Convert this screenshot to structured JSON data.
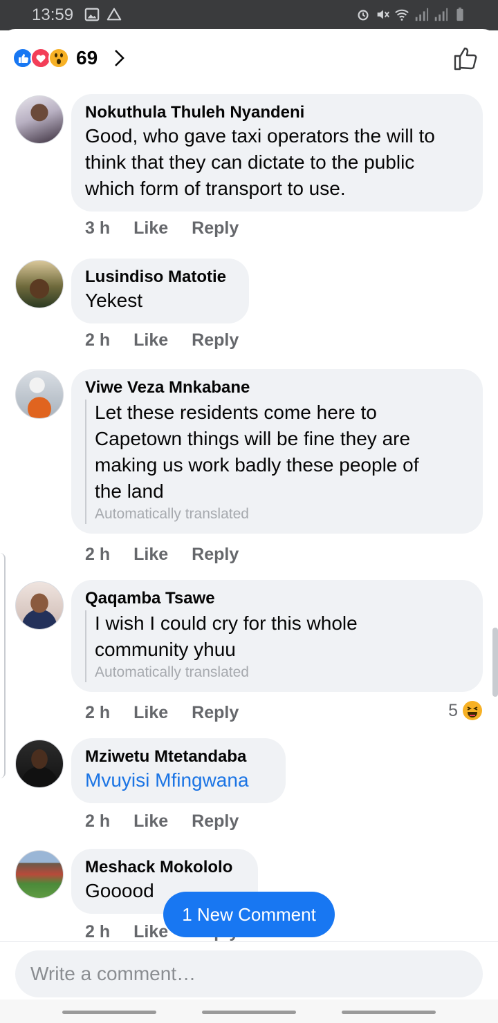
{
  "status_bar": {
    "time": "13:59",
    "left_icons": [
      "image-icon",
      "drive-icon"
    ],
    "right_icons": [
      "alarm-icon",
      "mute-icon",
      "wifi-icon",
      "signal-icon",
      "signal-icon",
      "battery-icon"
    ]
  },
  "reactions": {
    "types": [
      "like",
      "love",
      "wow"
    ],
    "count": "69"
  },
  "comments": [
    {
      "author": "Nokuthula Thuleh Nyandeni",
      "lines": [
        "Good, who gave taxi operators the will to",
        "think that they can dictate to the public",
        "which form of transport to use."
      ],
      "time": "3 h",
      "like": "Like",
      "reply": "Reply"
    },
    {
      "author": "Lusindiso Matotie",
      "lines": [
        "Yekest"
      ],
      "time": "2 h",
      "like": "Like",
      "reply": "Reply"
    },
    {
      "author": "Viwe Veza Mnkabane",
      "lines": [
        "Let these residents come here to",
        "Capetown things will be fine they are",
        "making us work badly these people of",
        "the land"
      ],
      "note": "Automatically translated",
      "time": "2 h",
      "like": "Like",
      "reply": "Reply"
    },
    {
      "author": "Qaqamba Tsawe",
      "lines": [
        "I wish I could cry for this whole",
        "community yhuu"
      ],
      "note": "Automatically translated",
      "time": "2 h",
      "like": "Like",
      "reply": "Reply",
      "reaction_count": "5"
    },
    {
      "author": "Mziwetu Mtetandaba",
      "tag": "Mvuyisi Mfingwana",
      "time": "2 h",
      "like": "Like",
      "reply": "Reply"
    },
    {
      "author": "Meshack Mokololo",
      "lines": [
        "Gooood"
      ],
      "time": "2 h",
      "like": "Like",
      "reply": "Reply"
    }
  ],
  "new_comment_button": "1 New Comment",
  "composer": {
    "placeholder": "Write a comment…"
  },
  "colors": {
    "accent": "#1877f2",
    "bubble": "#f0f2f5",
    "meta_text": "#65676b",
    "tag_link": "#1b74e4"
  }
}
